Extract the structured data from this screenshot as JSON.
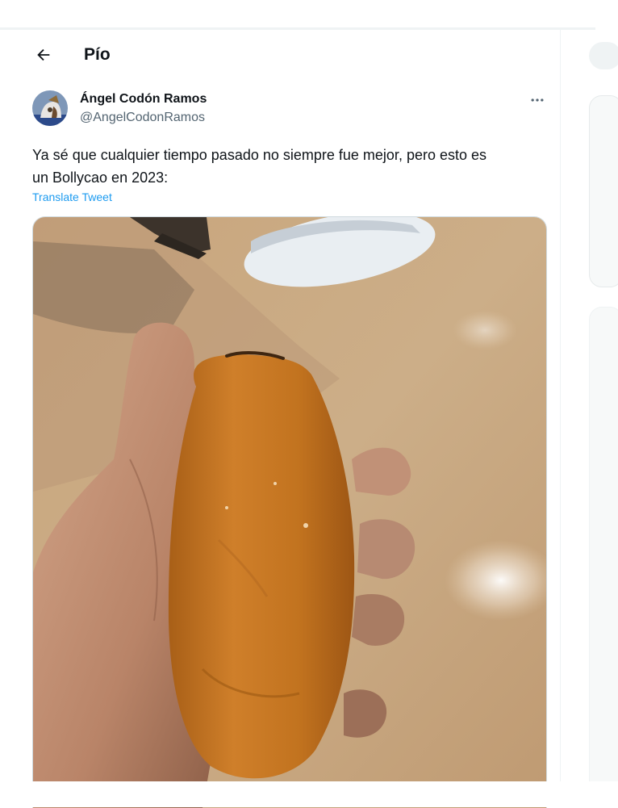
{
  "header": {
    "title": "Pío"
  },
  "tweet": {
    "author_name": "Ángel Codón Ramos",
    "author_handle": "@AngelCodonRamos",
    "text_line1": "Ya sé que cualquier tiempo pasado no siempre fue mejor, pero esto es",
    "text_line2": "un Bollycao en 2023:",
    "translate_label": "Translate Tweet"
  },
  "icons": {
    "back": "arrow-left-icon",
    "more": "more-horizontal-icon"
  },
  "colors": {
    "link": "#1d9bf0",
    "secondary_text": "#536471",
    "border": "#eff3f4"
  }
}
